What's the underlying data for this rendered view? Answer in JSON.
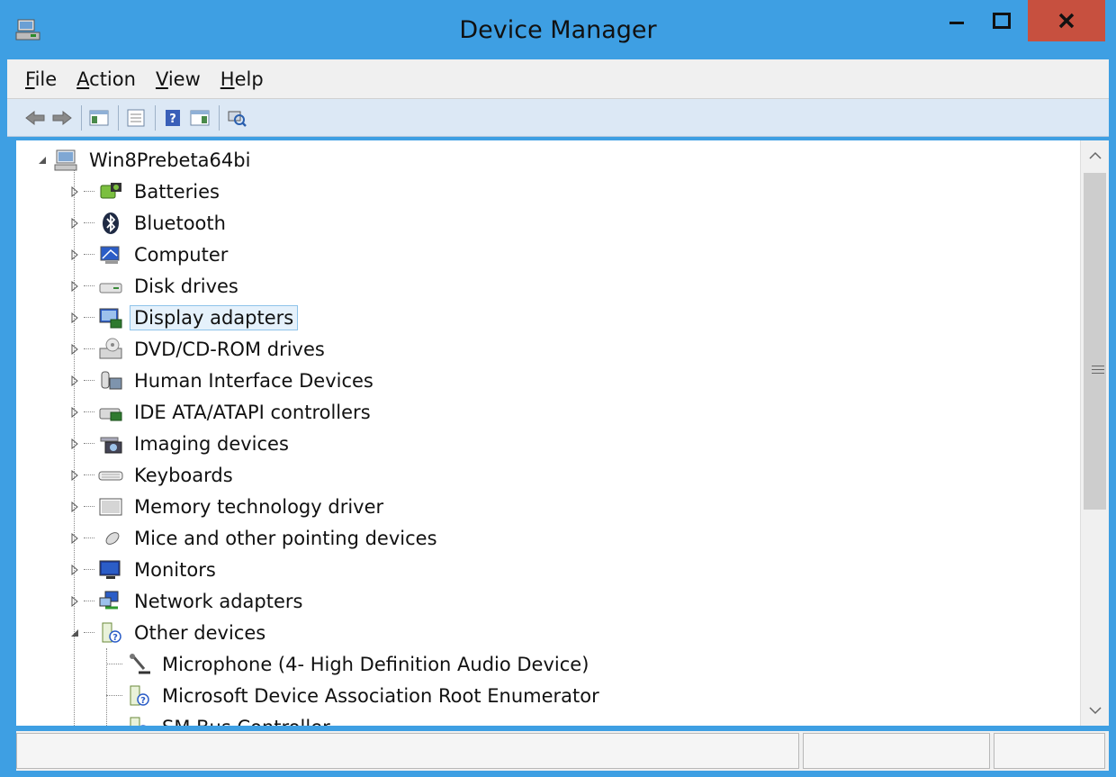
{
  "window": {
    "title": "Device Manager",
    "colors": {
      "titlebar": "#3e9fe3",
      "close": "#c7503f",
      "selection": "#e5f1fb"
    }
  },
  "menu": [
    {
      "key": "F",
      "rest": "ile"
    },
    {
      "key": "A",
      "rest": "ction"
    },
    {
      "key": "V",
      "rest": "iew"
    },
    {
      "key": "H",
      "rest": "elp"
    }
  ],
  "toolbar": {
    "buttons": [
      "back-icon",
      "forward-icon",
      "show-hide-console-tree-icon",
      "properties-icon",
      "help-icon",
      "show-action-pane-icon",
      "scan-hardware-icon"
    ]
  },
  "tree": {
    "root": {
      "label": "Win8Prebeta64bi",
      "icon": "computer-root-icon"
    },
    "categories": [
      {
        "label": "Batteries",
        "icon": "battery-icon"
      },
      {
        "label": "Bluetooth",
        "icon": "bluetooth-icon"
      },
      {
        "label": "Computer",
        "icon": "computer-icon"
      },
      {
        "label": "Disk drives",
        "icon": "disk-drive-icon"
      },
      {
        "label": "Display adapters",
        "icon": "display-adapter-icon",
        "selected": true
      },
      {
        "label": "DVD/CD-ROM drives",
        "icon": "dvd-drive-icon"
      },
      {
        "label": "Human Interface Devices",
        "icon": "hid-icon"
      },
      {
        "label": "IDE ATA/ATAPI controllers",
        "icon": "ide-controller-icon"
      },
      {
        "label": "Imaging devices",
        "icon": "imaging-device-icon"
      },
      {
        "label": "Keyboards",
        "icon": "keyboard-icon"
      },
      {
        "label": "Memory technology driver",
        "icon": "memory-icon"
      },
      {
        "label": "Mice and other pointing devices",
        "icon": "mouse-icon"
      },
      {
        "label": "Monitors",
        "icon": "monitor-icon"
      },
      {
        "label": "Network adapters",
        "icon": "network-adapter-icon"
      },
      {
        "label": "Other devices",
        "icon": "unknown-device-icon",
        "expanded": true
      }
    ],
    "other_devices_children": [
      {
        "label": "Microphone (4- High Definition Audio Device)",
        "icon": "microphone-icon"
      },
      {
        "label": "Microsoft Device Association Root Enumerator",
        "icon": "unknown-device-icon"
      },
      {
        "label": "SM Bus Controller",
        "icon": "unknown-device-icon"
      }
    ]
  }
}
